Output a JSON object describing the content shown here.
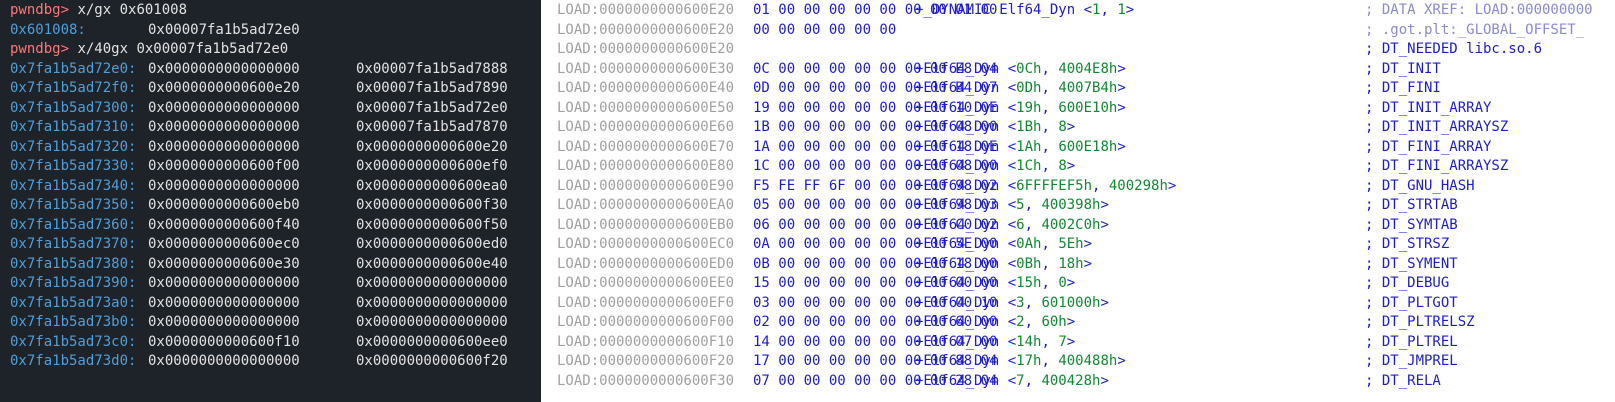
{
  "terminal": {
    "prompt": "pwndbg>",
    "lines": [
      {
        "kind": "cmd",
        "text": "x/gx 0x601008"
      },
      {
        "kind": "out",
        "addr": "0x601008:",
        "v1": "0x00007fa1b5ad72e0",
        "v2": ""
      },
      {
        "kind": "cmd",
        "text": "x/40gx 0x00007fa1b5ad72e0"
      },
      {
        "kind": "out",
        "addr": "0x7fa1b5ad72e0:",
        "v1": "0x0000000000000000",
        "v2": "0x00007fa1b5ad7888"
      },
      {
        "kind": "out",
        "addr": "0x7fa1b5ad72f0:",
        "v1": "0x0000000000600e20",
        "v2": "0x00007fa1b5ad7890"
      },
      {
        "kind": "out",
        "addr": "0x7fa1b5ad7300:",
        "v1": "0x0000000000000000",
        "v2": "0x00007fa1b5ad72e0"
      },
      {
        "kind": "out",
        "addr": "0x7fa1b5ad7310:",
        "v1": "0x0000000000000000",
        "v2": "0x00007fa1b5ad7870"
      },
      {
        "kind": "out",
        "addr": "0x7fa1b5ad7320:",
        "v1": "0x0000000000000000",
        "v2": "0x0000000000600e20"
      },
      {
        "kind": "out",
        "addr": "0x7fa1b5ad7330:",
        "v1": "0x0000000000600f00",
        "v2": "0x0000000000600ef0"
      },
      {
        "kind": "out",
        "addr": "0x7fa1b5ad7340:",
        "v1": "0x0000000000000000",
        "v2": "0x0000000000600ea0"
      },
      {
        "kind": "out",
        "addr": "0x7fa1b5ad7350:",
        "v1": "0x0000000000600eb0",
        "v2": "0x0000000000600f30"
      },
      {
        "kind": "out",
        "addr": "0x7fa1b5ad7360:",
        "v1": "0x0000000000600f40",
        "v2": "0x0000000000600f50"
      },
      {
        "kind": "out",
        "addr": "0x7fa1b5ad7370:",
        "v1": "0x0000000000600ec0",
        "v2": "0x0000000000600ed0"
      },
      {
        "kind": "out",
        "addr": "0x7fa1b5ad7380:",
        "v1": "0x0000000000600e30",
        "v2": "0x0000000000600e40"
      },
      {
        "kind": "out",
        "addr": "0x7fa1b5ad7390:",
        "v1": "0x0000000000000000",
        "v2": "0x0000000000000000"
      },
      {
        "kind": "out",
        "addr": "0x7fa1b5ad73a0:",
        "v1": "0x0000000000000000",
        "v2": "0x0000000000000000"
      },
      {
        "kind": "out",
        "addr": "0x7fa1b5ad73b0:",
        "v1": "0x0000000000000000",
        "v2": "0x0000000000000000"
      },
      {
        "kind": "out",
        "addr": "0x7fa1b5ad73c0:",
        "v1": "0x0000000000600f10",
        "v2": "0x0000000000600ee0"
      },
      {
        "kind": "out",
        "addr": "0x7fa1b5ad73d0:",
        "v1": "0x0000000000000000",
        "v2": "0x0000000000600f20"
      }
    ]
  },
  "ida": {
    "rows": [
      {
        "arrow": true,
        "seg": "LOAD:0000000000600E20",
        "bytes": "01 00 00 00 00 00 00 00 01 00",
        "inst_pre": "+_DYNAMIC Elf64_Dyn <",
        "n1": "1",
        "sep": ", ",
        "n2": "1",
        "inst_post": ">",
        "cmt": "; DATA XREF: LOAD:000000000",
        "cmt_kind": "xref"
      },
      {
        "arrow": false,
        "seg": "LOAD:0000000000600E20",
        "bytes": "00 00 00 00 00 00",
        "inst_pre": "",
        "n1": "",
        "sep": "",
        "n2": "",
        "inst_post": "",
        "cmt": "; .got.plt:_GLOBAL_OFFSET_",
        "cmt_kind": "xref"
      },
      {
        "arrow": false,
        "seg": "LOAD:0000000000600E20",
        "bytes": "",
        "inst_pre": "",
        "n1": "",
        "sep": "",
        "n2": "",
        "inst_post": "",
        "cmt": "; DT_NEEDED libc.so.6",
        "cmt_kind": "dt"
      },
      {
        "arrow": true,
        "seg": "LOAD:0000000000600E30",
        "bytes": "0C 00 00 00 00 00 00 00 E8 04",
        "inst_pre": "+Elf64_Dyn <",
        "n1": "0Ch",
        "sep": ", ",
        "n2": "4004E8h",
        "inst_post": ">",
        "cmt": "; DT_INIT",
        "cmt_kind": "dt"
      },
      {
        "arrow": true,
        "seg": "LOAD:0000000000600E40",
        "bytes": "0D 00 00 00 00 00 00 00 B4 07",
        "inst_pre": "+Elf64_Dyn <",
        "n1": "0Dh",
        "sep": ", ",
        "n2": "4007B4h",
        "inst_post": ">",
        "cmt": "; DT_FINI",
        "cmt_kind": "dt"
      },
      {
        "arrow": true,
        "seg": "LOAD:0000000000600E50",
        "bytes": "19 00 00 00 00 00 00 00 10 0E",
        "inst_pre": "+Elf64_Dyn <",
        "n1": "19h",
        "sep": ", ",
        "n2": "600E10h",
        "inst_post": ">",
        "cmt": "; DT_INIT_ARRAY",
        "cmt_kind": "dt"
      },
      {
        "arrow": true,
        "seg": "LOAD:0000000000600E60",
        "bytes": "1B 00 00 00 00 00 00 00 08 00",
        "inst_pre": "+Elf64_Dyn <",
        "n1": "1Bh",
        "sep": ", ",
        "n2": "8",
        "inst_post": ">",
        "cmt": "; DT_INIT_ARRAYSZ",
        "cmt_kind": "dt"
      },
      {
        "arrow": true,
        "seg": "LOAD:0000000000600E70",
        "bytes": "1A 00 00 00 00 00 00 00 18 0E",
        "inst_pre": "+Elf64_Dyn <",
        "n1": "1Ah",
        "sep": ", ",
        "n2": "600E18h",
        "inst_post": ">",
        "cmt": "; DT_FINI_ARRAY",
        "cmt_kind": "dt"
      },
      {
        "arrow": true,
        "seg": "LOAD:0000000000600E80",
        "bytes": "1C 00 00 00 00 00 00 00 08 00",
        "inst_pre": "+Elf64_Dyn <",
        "n1": "1Ch",
        "sep": ", ",
        "n2": "8",
        "inst_post": ">",
        "cmt": "; DT_FINI_ARRAYSZ",
        "cmt_kind": "dt"
      },
      {
        "arrow": true,
        "seg": "LOAD:0000000000600E90",
        "bytes": "F5 FE FF 6F 00 00 00 00 98 02",
        "inst_pre": "+Elf64_Dyn <",
        "n1": "6FFFFEF5h",
        "sep": ", ",
        "n2": "400298h",
        "inst_post": ">",
        "cmt": "; DT_GNU_HASH",
        "cmt_kind": "dt"
      },
      {
        "arrow": true,
        "seg": "LOAD:0000000000600EA0",
        "bytes": "05 00 00 00 00 00 00 00 98 03",
        "inst_pre": "+Elf64_Dyn <",
        "n1": "5",
        "sep": ", ",
        "n2": "400398h",
        "inst_post": ">",
        "cmt": "; DT_STRTAB",
        "cmt_kind": "dt"
      },
      {
        "arrow": true,
        "seg": "LOAD:0000000000600EB0",
        "bytes": "06 00 00 00 00 00 00 00 C0 02",
        "inst_pre": "+Elf64_Dyn <",
        "n1": "6",
        "sep": ", ",
        "n2": "4002C0h",
        "inst_post": ">",
        "cmt": "; DT_SYMTAB",
        "cmt_kind": "dt"
      },
      {
        "arrow": true,
        "seg": "LOAD:0000000000600EC0",
        "bytes": "0A 00 00 00 00 00 00 00 5E 00",
        "inst_pre": "+Elf64_Dyn <",
        "n1": "0Ah",
        "sep": ", ",
        "n2": "5Eh",
        "inst_post": ">",
        "cmt": "; DT_STRSZ",
        "cmt_kind": "dt"
      },
      {
        "arrow": true,
        "seg": "LOAD:0000000000600ED0",
        "bytes": "0B 00 00 00 00 00 00 00 18 00",
        "inst_pre": "+Elf64_Dyn <",
        "n1": "0Bh",
        "sep": ", ",
        "n2": "18h",
        "inst_post": ">",
        "cmt": "; DT_SYMENT",
        "cmt_kind": "dt"
      },
      {
        "arrow": true,
        "seg": "LOAD:0000000000600EE0",
        "bytes": "15 00 00 00 00 00 00 00 00 00",
        "inst_pre": "+Elf64_Dyn <",
        "n1": "15h",
        "sep": ", ",
        "n2": "0",
        "inst_post": ">",
        "cmt": "; DT_DEBUG",
        "cmt_kind": "dt"
      },
      {
        "arrow": true,
        "seg": "LOAD:0000000000600EF0",
        "bytes": "03 00 00 00 00 00 00 00 00 10",
        "inst_pre": "+Elf64_Dyn <",
        "n1": "3",
        "sep": ", ",
        "n2": "601000h",
        "inst_post": ">",
        "cmt": "; DT_PLTGOT",
        "cmt_kind": "dt"
      },
      {
        "arrow": true,
        "seg": "LOAD:0000000000600F00",
        "bytes": "02 00 00 00 00 00 00 00 60 00",
        "inst_pre": "+Elf64_Dyn <",
        "n1": "2",
        "sep": ", ",
        "n2": "60h",
        "inst_post": ">",
        "cmt": "; DT_PLTRELSZ",
        "cmt_kind": "dt"
      },
      {
        "arrow": true,
        "seg": "LOAD:0000000000600F10",
        "bytes": "14 00 00 00 00 00 00 00 07 00",
        "inst_pre": "+Elf64_Dyn <",
        "n1": "14h",
        "sep": ", ",
        "n2": "7",
        "inst_post": ">",
        "cmt": "; DT_PLTREL",
        "cmt_kind": "dt"
      },
      {
        "arrow": true,
        "seg": "LOAD:0000000000600F20",
        "bytes": "17 00 00 00 00 00 00 00 88 04",
        "inst_pre": "+Elf64_Dyn <",
        "n1": "17h",
        "sep": ", ",
        "n2": "400488h",
        "inst_post": ">",
        "cmt": "; DT_JMPREL",
        "cmt_kind": "dt"
      },
      {
        "arrow": true,
        "seg": "LOAD:0000000000600F30",
        "bytes": "07 00 00 00 00 00 00 00 28 04",
        "inst_pre": "+Elf64_Dyn <",
        "n1": "7",
        "sep": ", ",
        "n2": "400428h",
        "inst_post": ">",
        "cmt": "; DT_RELA",
        "cmt_kind": "dt"
      }
    ]
  },
  "colors": {
    "terminal_bg": "#1e2229",
    "prompt": "#ff7777",
    "address": "#4f9fd8",
    "ida_bytes": "#1c1ccc",
    "ida_number": "#118833",
    "ida_segment": "#a0a0a0"
  }
}
